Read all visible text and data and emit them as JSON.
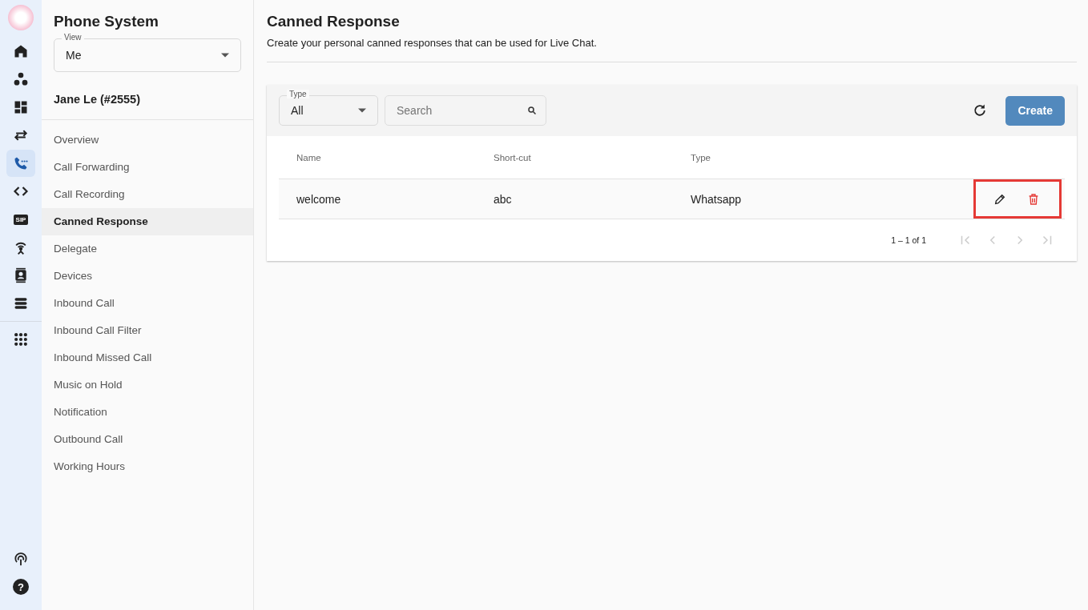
{
  "rail": {
    "items": [
      {
        "kind": "home",
        "selected": false
      },
      {
        "kind": "dots",
        "selected": false
      },
      {
        "kind": "dashboard",
        "selected": false
      },
      {
        "kind": "arrows",
        "selected": false
      },
      {
        "kind": "phone",
        "selected": true
      },
      {
        "kind": "code",
        "selected": false
      },
      {
        "kind": "sip",
        "label": "SIP",
        "selected": false
      },
      {
        "kind": "antenna",
        "selected": false
      },
      {
        "kind": "contact",
        "selected": false
      },
      {
        "kind": "server",
        "selected": false
      },
      {
        "kind": "apps",
        "selected": false
      }
    ],
    "bottom": [
      {
        "kind": "broadcast",
        "selected": false
      },
      {
        "kind": "help",
        "label": "?",
        "selected": false
      }
    ]
  },
  "sidebar": {
    "title": "Phone System",
    "view": {
      "label": "View",
      "value": "Me"
    },
    "user": "Jane Le (#2555)",
    "items": [
      {
        "label": "Overview",
        "selected": false
      },
      {
        "label": "Call Forwarding",
        "selected": false
      },
      {
        "label": "Call Recording",
        "selected": false
      },
      {
        "label": "Canned Response",
        "selected": true
      },
      {
        "label": "Delegate",
        "selected": false
      },
      {
        "label": "Devices",
        "selected": false
      },
      {
        "label": "Inbound Call",
        "selected": false
      },
      {
        "label": "Inbound Call Filter",
        "selected": false
      },
      {
        "label": "Inbound Missed Call",
        "selected": false
      },
      {
        "label": "Music on Hold",
        "selected": false
      },
      {
        "label": "Notification",
        "selected": false
      },
      {
        "label": "Outbound Call",
        "selected": false
      },
      {
        "label": "Working Hours",
        "selected": false
      }
    ]
  },
  "page": {
    "title": "Canned Response",
    "subtitle": "Create your personal canned responses that can be used for Live Chat."
  },
  "toolbar": {
    "type_filter": {
      "label": "Type",
      "value": "All"
    },
    "search": {
      "placeholder": "Search"
    },
    "create_button": "Create"
  },
  "table": {
    "columns": [
      "Name",
      "Short-cut",
      "Type"
    ],
    "rows": [
      {
        "cells": [
          "welcome",
          "abc",
          "Whatsapp"
        ],
        "actions_highlighted": true
      }
    ]
  },
  "pagination": {
    "range": "1 – 1 of 1",
    "first_disabled": true,
    "prev_disabled": true,
    "next_disabled": true,
    "last_disabled": true
  }
}
